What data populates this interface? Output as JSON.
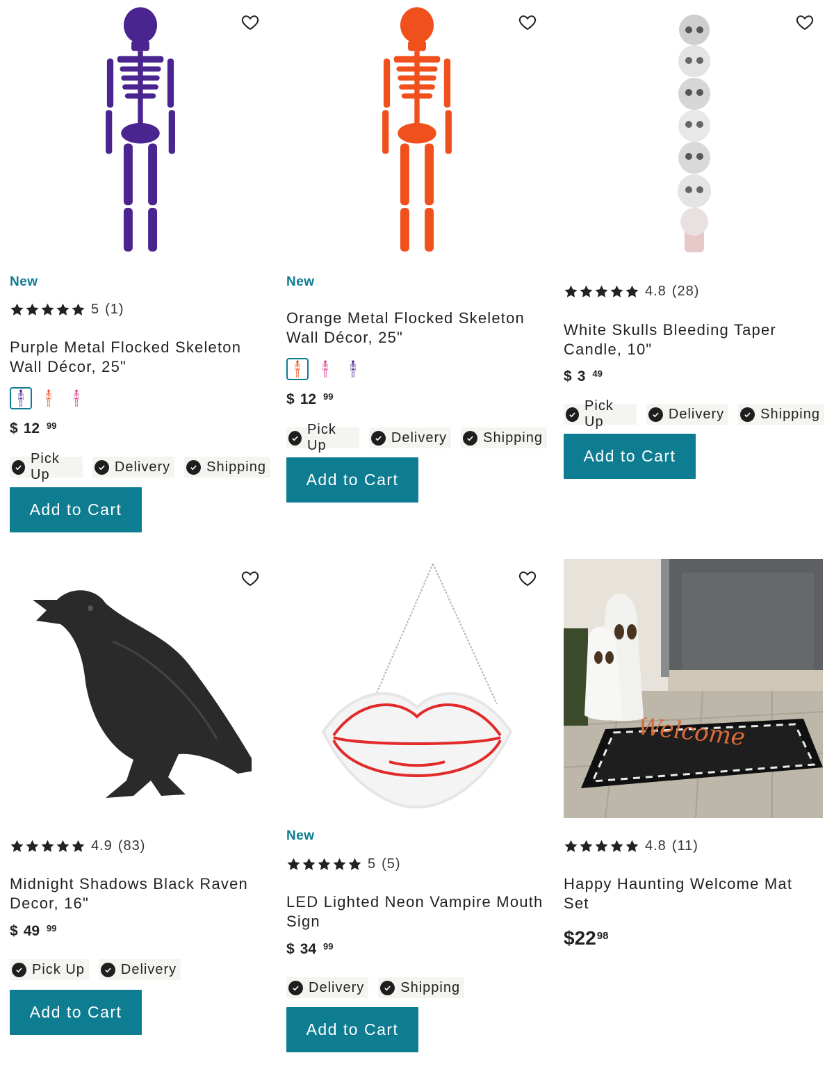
{
  "colors": {
    "accent": "#0e7c91",
    "chip_bg": "#f4f4f0",
    "text": "#222222"
  },
  "icons": {
    "wishlist": "heart-outline-icon",
    "star": "star-icon",
    "check": "check-circle-icon"
  },
  "fulfillment_labels": {
    "pickup": "Pick Up",
    "delivery": "Delivery",
    "shipping": "Shipping"
  },
  "add_to_cart_label": "Add to Cart",
  "products": [
    {
      "badge": "New",
      "rating": "5",
      "review_count": "(1)",
      "title": "Purple Metal Flocked Skeleton Wall Décor, 25\"",
      "swatches": [
        "purple",
        "orange",
        "pink"
      ],
      "selected_swatch": "purple",
      "price": {
        "dollar": "$",
        "whole": "12",
        "cents": "99"
      },
      "fulfillment": [
        "Pick Up",
        "Delivery",
        "Shipping"
      ],
      "wishlist": true
    },
    {
      "badge": "New",
      "title": "Orange Metal Flocked Skeleton Wall Décor, 25\"",
      "swatches": [
        "orange",
        "pink",
        "purple"
      ],
      "selected_swatch": "orange",
      "price": {
        "dollar": "$",
        "whole": "12",
        "cents": "99"
      },
      "fulfillment": [
        "Pick Up",
        "Delivery",
        "Shipping"
      ],
      "wishlist": true
    },
    {
      "rating": "4.8",
      "review_count": "(28)",
      "title": "White Skulls Bleeding Taper Candle, 10\"",
      "price": {
        "dollar": "$",
        "whole": "3",
        "cents": "49"
      },
      "fulfillment": [
        "Pick Up",
        "Delivery",
        "Shipping"
      ],
      "wishlist": true
    },
    {
      "rating": "4.9",
      "review_count": "(83)",
      "title": "Midnight Shadows Black Raven Decor, 16\"",
      "price": {
        "dollar": "$",
        "whole": "49",
        "cents": "99"
      },
      "fulfillment": [
        "Pick Up",
        "Delivery"
      ],
      "wishlist": true
    },
    {
      "badge": "New",
      "rating": "5",
      "review_count": "(5)",
      "title": "LED Lighted Neon Vampire Mouth Sign",
      "price": {
        "dollar": "$",
        "whole": "34",
        "cents": "99"
      },
      "fulfillment": [
        "Delivery",
        "Shipping"
      ],
      "wishlist": true
    },
    {
      "rating": "4.8",
      "review_count": "(11)",
      "title": "Happy Haunting Welcome Mat Set",
      "price": {
        "dollar": "$",
        "whole": "22",
        "cents": "98"
      },
      "image_text": "Welcome"
    }
  ]
}
